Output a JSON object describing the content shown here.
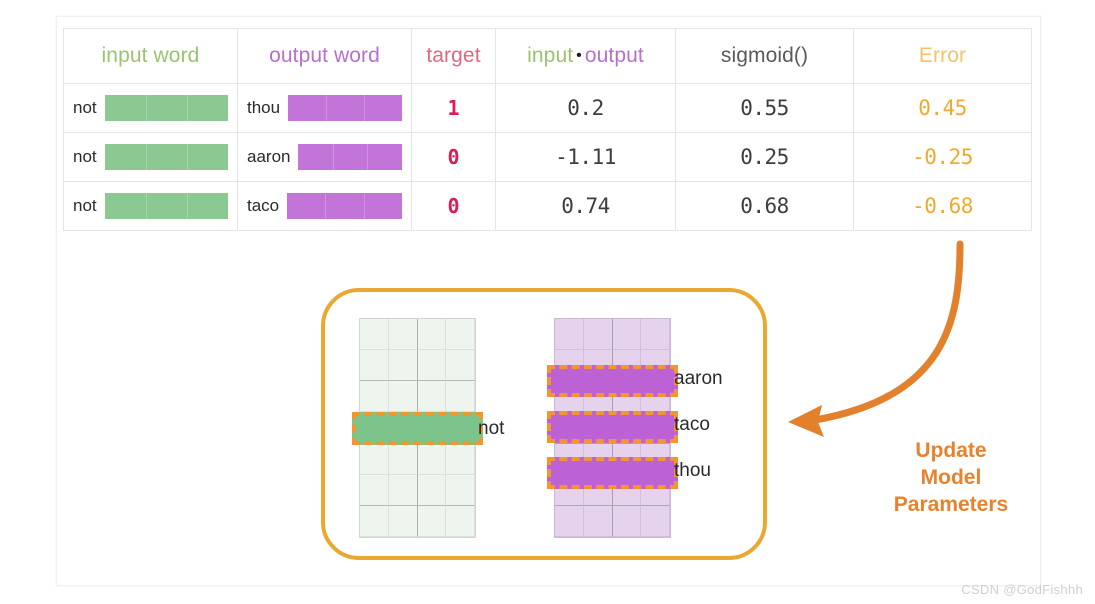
{
  "table": {
    "headers": {
      "input_word": "input word",
      "output_word": "output word",
      "target": "target",
      "dot_input": "input",
      "dot_symbol": "•",
      "dot_output": "output",
      "sigmoid": "sigmoid()",
      "error": "Error"
    },
    "rows": [
      {
        "input_word": "not",
        "output_word": "thou",
        "target": "1",
        "dot": "0.2",
        "sigmoid": "0.55",
        "error": "0.45"
      },
      {
        "input_word": "not",
        "output_word": "aaron",
        "target": "0",
        "dot": "-1.11",
        "sigmoid": "0.25",
        "error": "-0.25"
      },
      {
        "input_word": "not",
        "output_word": "taco",
        "target": "0",
        "dot": "0.74",
        "sigmoid": "0.68",
        "error": "-0.68"
      }
    ]
  },
  "diagram": {
    "input_matrix": {
      "name": "input-embedding-matrix",
      "rows": 7,
      "cols": 4,
      "highlighted_row_index": 3,
      "highlighted_label": "not"
    },
    "output_matrix": {
      "name": "output-embedding-matrix",
      "rows": 7,
      "cols": 4,
      "highlighted_row_indices": [
        1,
        3,
        5
      ],
      "highlighted_labels": [
        "aaron",
        "taco",
        "thou"
      ]
    },
    "arrow": {
      "name": "update-arrow",
      "direction": "down-left"
    },
    "caption": {
      "line1": "Update",
      "line2": "Model",
      "line3": "Parameters"
    }
  },
  "colors": {
    "green_vector": "#8cc992",
    "purple_vector": "#c274d9",
    "target_red": "#d81e56",
    "error_orange": "#f0a92e",
    "highlight_dash": "#f2962f",
    "box_border": "#eaa832",
    "arrow": "#e8822c",
    "header_green": "#9ac46f",
    "header_purple": "#b96fd0",
    "header_rose": "#e2687f",
    "header_amber": "#f0c46a"
  },
  "watermark": "CSDN @GodFishhh"
}
